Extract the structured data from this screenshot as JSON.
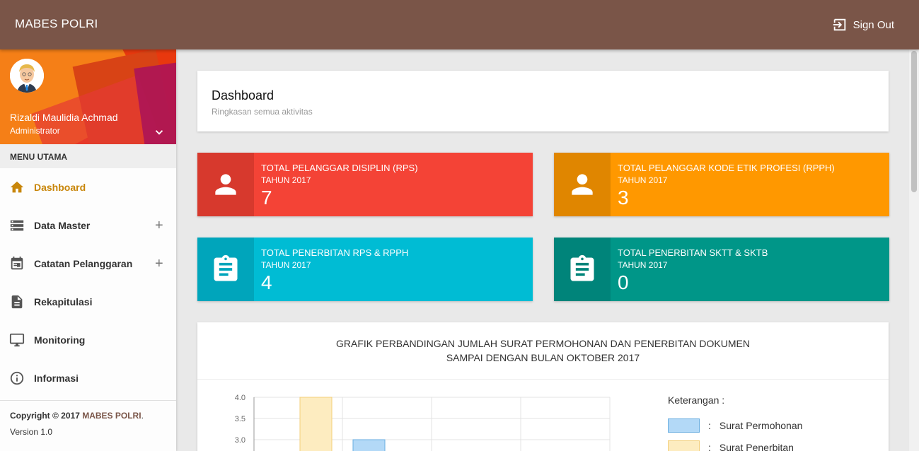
{
  "topbar": {
    "brand": "MABES POLRI",
    "signout_label": "Sign Out"
  },
  "user": {
    "name": "Rizaldi Maulidia Achmad",
    "role": "Administrator"
  },
  "sidebar": {
    "menu_header": "MENU UTAMA",
    "items": [
      {
        "label": "Dashboard",
        "icon": "home-icon",
        "active": true
      },
      {
        "label": "Data Master",
        "icon": "storage-icon",
        "expandable": true
      },
      {
        "label": "Catatan Pelanggaran",
        "icon": "calendar-icon",
        "expandable": true
      },
      {
        "label": "Rekapitulasi",
        "icon": "document-icon"
      },
      {
        "label": "Monitoring",
        "icon": "monitor-icon"
      },
      {
        "label": "Informasi",
        "icon": "info-icon"
      }
    ],
    "plus_symbol": "+",
    "footer": {
      "copyright_prefix": "Copyright © 2017",
      "copyright_brand": "MABES POLRI",
      "copyright_suffix": ".",
      "version": "Version 1.0"
    }
  },
  "page": {
    "title": "Dashboard",
    "subtitle": "Ringkasan semua aktivitas"
  },
  "infoboxes": [
    {
      "title": "TOTAL PELANGGAR DISIPLIN (RPS)",
      "subtitle": "TAHUN 2017",
      "value": "7",
      "icon": "person-icon",
      "color": "#f44336",
      "icon_bg": "#d7392d"
    },
    {
      "title": "TOTAL PELANGGAR KODE ETIK PROFESI (RPPH)",
      "subtitle": "TAHUN 2017",
      "value": "3",
      "icon": "person-icon",
      "color": "#ff9800",
      "icon_bg": "#e08600"
    },
    {
      "title": "TOTAL PENERBITAN RPS & RPPH",
      "subtitle": "TAHUN 2017",
      "value": "4",
      "icon": "clipboard-icon",
      "color": "#00bcd4",
      "icon_bg": "#00a5bb"
    },
    {
      "title": "TOTAL PENERBITAN SKTT & SKTB",
      "subtitle": "TAHUN 2017",
      "value": "0",
      "icon": "clipboard-icon",
      "color": "#009688",
      "icon_bg": "#00847a"
    }
  ],
  "chart_section": {
    "title_line1": "GRAFIK PERBANDINGAN JUMLAH SURAT PERMOHONAN DAN PENERBITAN DOKUMEN",
    "title_line2": "SAMPAI DENGAN BULAN OKTOBER 2017",
    "legend_title": "Keterangan :",
    "legend_separator": ":"
  },
  "chart_data": {
    "type": "bar",
    "title": "GRAFIK PERBANDINGAN JUMLAH SURAT PERMOHONAN DAN PENERBITAN DOKUMEN SAMPAI DENGAN BULAN OKTOBER 2017",
    "ylim": [
      0,
      4.0
    ],
    "y_ticks": [
      "4.0",
      "3.5",
      "3.0"
    ],
    "grid": true,
    "legend_position": "right",
    "series": [
      {
        "name": "Surat Permohonan",
        "color": "#b3d9f7",
        "border": "#6aaee0",
        "values": [
          null,
          3.0
        ]
      },
      {
        "name": "Surat Penerbitan",
        "color": "#fdecc0",
        "border": "#f3cf7a",
        "values": [
          4.0,
          null
        ]
      }
    ]
  },
  "colors": {
    "topbar": "#7a5548",
    "active_menu": "#c8860a"
  }
}
